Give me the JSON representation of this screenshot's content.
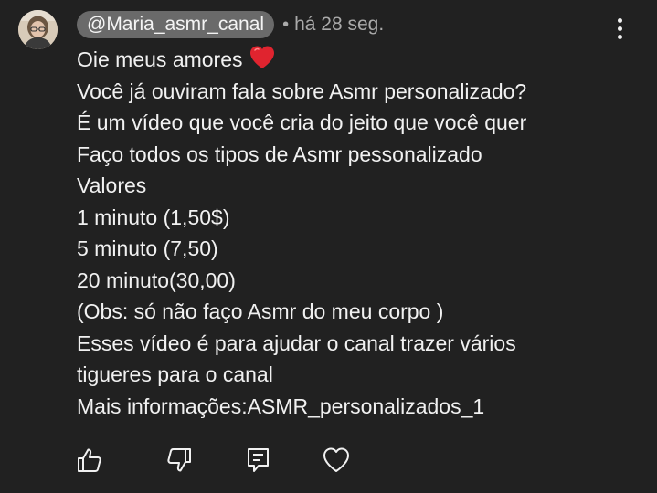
{
  "comment": {
    "author": "@Maria_asmr_canal",
    "separator": "•",
    "timestamp": "há 28 seg.",
    "lines": [
      "Oie meus amores",
      "Você já ouviram fala sobre Asmr personalizado?",
      "É um vídeo que você cria do jeito que você quer",
      "Faço todos os tipos de Asmr pessonalizado",
      "Valores",
      "1 minuto (1,50$)",
      "5 minuto (7,50)",
      "20 minuto(30,00)",
      "(Obs: só não faço Asmr do meu corpo )",
      "Esses vídeo é para ajudar o canal trazer vários",
      "tigueres para o canal",
      "Mais informações:ASMR_personalizados_1"
    ],
    "emoji": "red-heart"
  },
  "actions": {
    "like_icon": "thumbs-up-icon",
    "dislike_icon": "thumbs-down-icon",
    "reply_icon": "reply-icon",
    "heart_icon": "heart-icon",
    "menu_icon": "more-vertical-icon"
  },
  "colors": {
    "background": "#212121",
    "text": "#f1f1f1",
    "muted": "#aaaaaa",
    "author_chip": "#6a6a6a",
    "emoji_red": "#e0242f"
  }
}
